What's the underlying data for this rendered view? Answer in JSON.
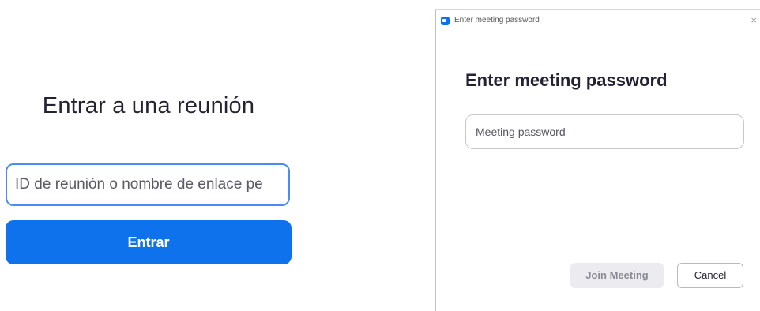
{
  "join_panel": {
    "title": "Entrar a una reunión",
    "meeting_id_value": "ID de reunión o nombre de enlace pe",
    "join_label": "Entrar"
  },
  "password_dialog": {
    "window_title": "Enter meeting password",
    "close_glyph": "×",
    "heading": "Enter meeting password",
    "password_placeholder": "Meeting password",
    "join_meeting_label": "Join Meeting",
    "cancel_label": "Cancel"
  },
  "colors": {
    "primary_blue": "#0e72ed",
    "input_focus_border": "#4a8cf7",
    "disabled_button_bg": "#ececf0"
  }
}
